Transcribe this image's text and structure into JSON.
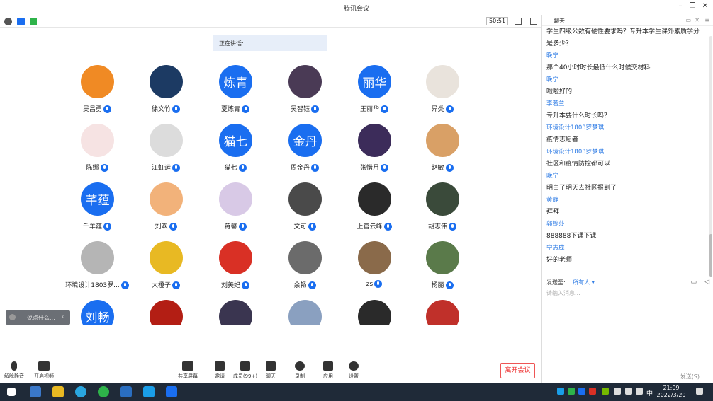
{
  "window": {
    "title": "腾讯会议"
  },
  "toolbar": {
    "timer": "50:51"
  },
  "speaking": {
    "label": "正在讲话:"
  },
  "participants": [
    {
      "name": "吴吕勇",
      "initials": "",
      "color": "#f08a24"
    },
    {
      "name": "徐文竹",
      "initials": "",
      "color": "#1c3a63"
    },
    {
      "name": "夏炼青",
      "initials": "炼青",
      "color": "#1a6ef0"
    },
    {
      "name": "吴智钰",
      "initials": "",
      "color": "#4a3a55"
    },
    {
      "name": "王丽华",
      "initials": "丽华",
      "color": "#1a6ef0"
    },
    {
      "name": "异类",
      "initials": "",
      "color": "#e9e3dc"
    },
    {
      "name": "陈娜",
      "initials": "",
      "color": "#f6e3e3"
    },
    {
      "name": "江虹运",
      "initials": "",
      "color": "#dcdcdc"
    },
    {
      "name": "猫七",
      "initials": "猫七",
      "color": "#1a6ef0"
    },
    {
      "name": "周金丹",
      "initials": "金丹",
      "color": "#1a6ef0"
    },
    {
      "name": "张惜月",
      "initials": "",
      "color": "#3c2c5a"
    },
    {
      "name": "赵敏",
      "initials": "",
      "color": "#d9a066"
    },
    {
      "name": "千羊蕴",
      "initials": "芊蕴",
      "color": "#1a6ef0"
    },
    {
      "name": "刘欢",
      "initials": "",
      "color": "#f2b27a"
    },
    {
      "name": "蒋馨",
      "initials": "",
      "color": "#d8c9e6"
    },
    {
      "name": "文可",
      "initials": "",
      "color": "#4a4a4a"
    },
    {
      "name": "上官云峰",
      "initials": "",
      "color": "#2a2a2a"
    },
    {
      "name": "胡志伟",
      "initials": "",
      "color": "#3a4a3a"
    },
    {
      "name": "环境设计1803罗...",
      "initials": "",
      "color": "#b5b5b5"
    },
    {
      "name": "大橙子",
      "initials": "",
      "color": "#e8b923"
    },
    {
      "name": "刘美妃",
      "initials": "",
      "color": "#d93025"
    },
    {
      "name": "余畅",
      "initials": "",
      "color": "#6b6b6b"
    },
    {
      "name": "zs",
      "initials": "",
      "color": "#8a6a4a"
    },
    {
      "name": "杨丽",
      "initials": "",
      "color": "#5a7a4a"
    },
    {
      "name": "",
      "initials": "刘畅",
      "color": "#1a6ef0"
    },
    {
      "name": "",
      "initials": "",
      "color": "#b31e14"
    },
    {
      "name": "",
      "initials": "",
      "color": "#3a3550"
    },
    {
      "name": "",
      "initials": "",
      "color": "#8aa0c0"
    },
    {
      "name": "",
      "initials": "",
      "color": "#2a2a2a"
    },
    {
      "name": "",
      "initials": "",
      "color": "#c0302a"
    }
  ],
  "float_chat": {
    "placeholder": "说点什么..."
  },
  "bottombar": {
    "mute": "解除静音",
    "video": "开启视频",
    "share": "共享屏幕",
    "invite": "邀请",
    "members": "成员(99+)",
    "chat": "聊天",
    "record": "录制",
    "apps": "应用",
    "settings": "设置",
    "leave": "离开会议"
  },
  "chat": {
    "header": "聊天",
    "messages": [
      {
        "type": "text",
        "text": "学生四级公数有硬性要求吗？专升本学生课外素质学分"
      },
      {
        "type": "text",
        "text": "是多少？"
      },
      {
        "type": "sender",
        "text": "晚宁"
      },
      {
        "type": "text",
        "text": "那个40小时时长最低什么时候交材料"
      },
      {
        "type": "sender",
        "text": "晚宁"
      },
      {
        "type": "text",
        "text": "啦啦好的"
      },
      {
        "type": "sender",
        "text": "李若兰"
      },
      {
        "type": "text",
        "text": "专升本要什么时长吗？"
      },
      {
        "type": "sender",
        "text": "环境设计1803罗梦琪"
      },
      {
        "type": "text",
        "text": "疫情志愿者"
      },
      {
        "type": "sender",
        "text": "环境设计1803罗梦琪"
      },
      {
        "type": "text",
        "text": "社区和疫情防控都可以"
      },
      {
        "type": "sender",
        "text": "晚宁"
      },
      {
        "type": "text",
        "text": "明白了明天去社区报到了"
      },
      {
        "type": "sender",
        "text": "黄静"
      },
      {
        "type": "text",
        "text": "拜拜"
      },
      {
        "type": "sender",
        "text": "郭婉莎"
      },
      {
        "type": "text",
        "text": "888888下课下课"
      },
      {
        "type": "sender",
        "text": "宁志成"
      },
      {
        "type": "text",
        "text": "好的老师"
      }
    ],
    "sendto_label": "发送至:",
    "sendto_value": "所有人",
    "input_placeholder": "请输入消息...",
    "send_label": "发送(S)"
  },
  "taskbar": {
    "time": "21:09",
    "date": "2022/3/20",
    "ime": "中"
  }
}
